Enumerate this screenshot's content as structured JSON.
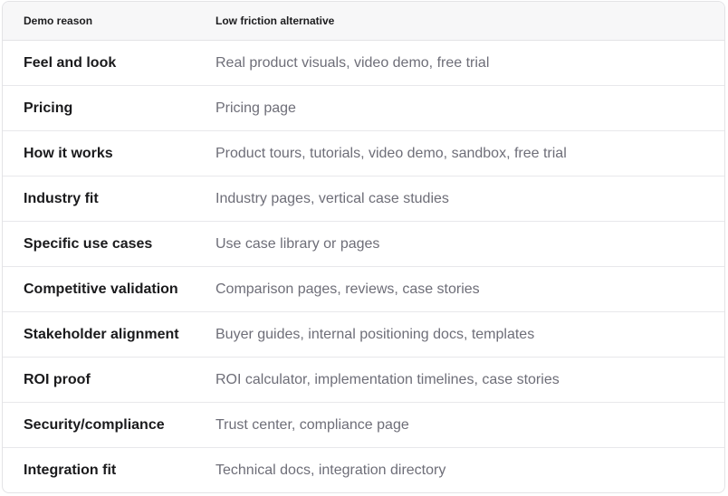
{
  "table": {
    "headers": {
      "reason": "Demo reason",
      "alternative": "Low friction alternative"
    },
    "rows": [
      {
        "reason": "Feel and look",
        "alternative": "Real product visuals, video demo, free trial"
      },
      {
        "reason": "Pricing",
        "alternative": "Pricing page"
      },
      {
        "reason": "How it works",
        "alternative": "Product tours, tutorials, video demo, sandbox, free trial"
      },
      {
        "reason": "Industry fit",
        "alternative": "Industry pages, vertical case studies"
      },
      {
        "reason": "Specific use cases",
        "alternative": "Use case library or pages"
      },
      {
        "reason": "Competitive validation",
        "alternative": "Comparison pages, reviews, case stories"
      },
      {
        "reason": "Stakeholder alignment",
        "alternative": "Buyer guides, internal positioning docs, templates"
      },
      {
        "reason": "ROI proof",
        "alternative": "ROI calculator, implementation timelines, case stories"
      },
      {
        "reason": "Security/compliance",
        "alternative": "Trust center, compliance page"
      },
      {
        "reason": "Integration fit",
        "alternative": "Technical docs, integration directory"
      }
    ]
  }
}
